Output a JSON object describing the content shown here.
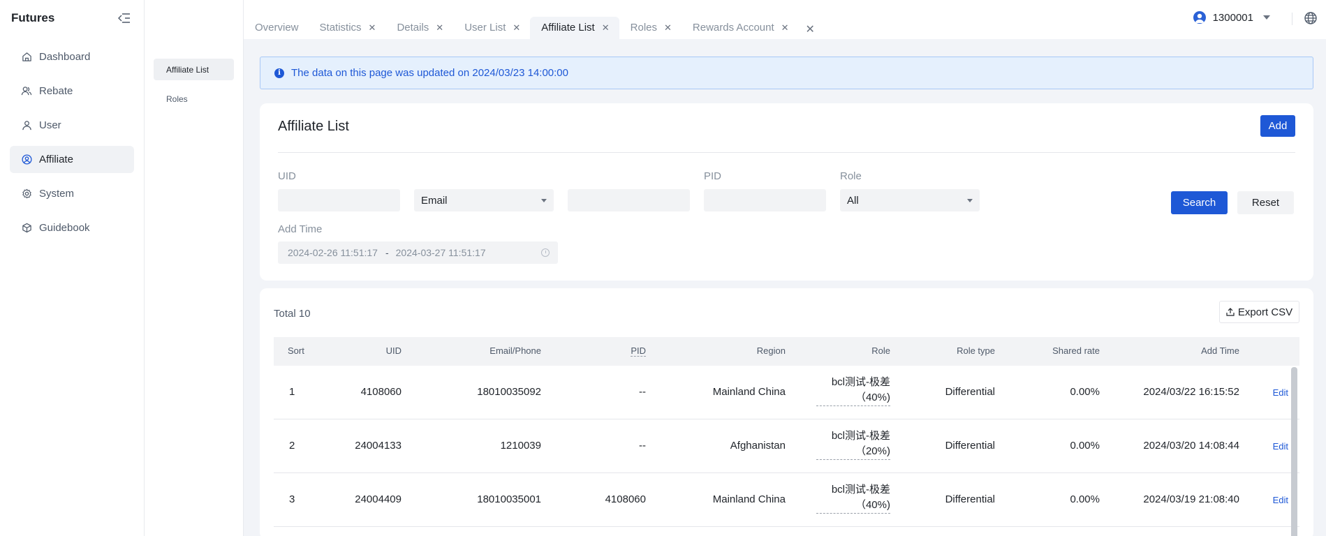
{
  "sidebar": {
    "brand": "Futures",
    "items": [
      {
        "label": "Dashboard",
        "icon": "home-icon"
      },
      {
        "label": "Rebate",
        "icon": "users-icon"
      },
      {
        "label": "User",
        "icon": "user-icon"
      },
      {
        "label": "Affiliate",
        "icon": "user-circle-icon",
        "active": true
      },
      {
        "label": "System",
        "icon": "gear-icon"
      },
      {
        "label": "Guidebook",
        "icon": "box-icon"
      }
    ]
  },
  "subnav": {
    "items": [
      {
        "label": "Affiliate List",
        "active": true
      },
      {
        "label": "Roles"
      }
    ]
  },
  "tabs": [
    {
      "label": "Overview",
      "closable": false
    },
    {
      "label": "Statistics",
      "closable": true
    },
    {
      "label": "Details",
      "closable": true
    },
    {
      "label": "User List",
      "closable": true
    },
    {
      "label": "Affiliate List",
      "closable": true,
      "active": true
    },
    {
      "label": "Roles",
      "closable": true
    },
    {
      "label": "Rewards Account",
      "closable": true
    }
  ],
  "user": {
    "id": "1300001"
  },
  "banner": {
    "text": "The data on this page was updated on 2024/03/23 14:00:00"
  },
  "filter": {
    "title": "Affiliate List",
    "add_label": "Add",
    "uid_label": "UID",
    "uid_value": "",
    "contact_type": "Email",
    "contact_value": "",
    "pid_label": "PID",
    "pid_value": "",
    "role_label": "Role",
    "role_value": "All",
    "search_label": "Search",
    "reset_label": "Reset",
    "time_label": "Add Time",
    "time_start": "2024-02-26 11:51:17",
    "time_sep": "-",
    "time_end": "2024-03-27 11:51:17"
  },
  "table": {
    "total": "Total 10",
    "export_label": "Export CSV",
    "headers": {
      "sort": "Sort",
      "uid": "UID",
      "email": "Email/Phone",
      "pid": "PID",
      "region": "Region",
      "role": "Role",
      "role_type": "Role type",
      "shared_rate": "Shared rate",
      "add_time": "Add Time"
    },
    "rows": [
      {
        "sort": "1",
        "uid": "4108060",
        "email": "18010035092",
        "pid": "--",
        "region": "Mainland China",
        "role": "bcl测试-极差（40%)",
        "role_type": "Differential",
        "shared_rate": "0.00%",
        "add_time": "2024/03/22 16:15:52",
        "action": "Edit"
      },
      {
        "sort": "2",
        "uid": "24004133",
        "email": "1210039",
        "pid": "--",
        "region": "Afghanistan",
        "role": "bcl测试-极差（20%)",
        "role_type": "Differential",
        "shared_rate": "0.00%",
        "add_time": "2024/03/20 14:08:44",
        "action": "Edit"
      },
      {
        "sort": "3",
        "uid": "24004409",
        "email": "18010035001",
        "pid": "4108060",
        "region": "Mainland China",
        "role": "bcl测试-极差（40%)",
        "role_type": "Differential",
        "shared_rate": "0.00%",
        "add_time": "2024/03/19 21:08:40",
        "action": "Edit"
      }
    ]
  }
}
